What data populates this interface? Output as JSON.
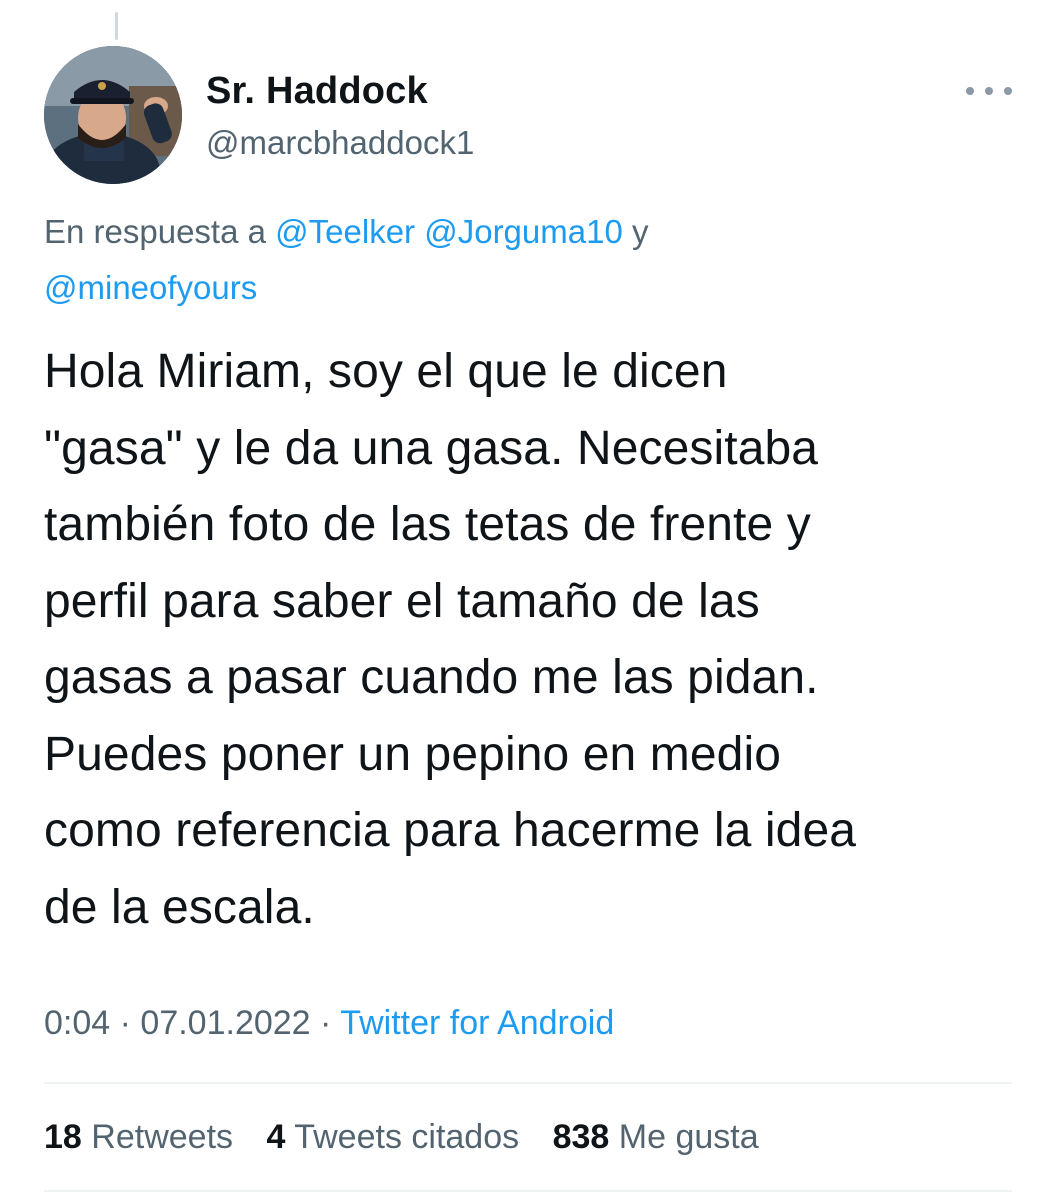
{
  "author": {
    "name": "Sr. Haddock",
    "handle": "@marcbhaddock1"
  },
  "reply_context": {
    "prefix": "En respuesta a",
    "mentions": [
      "@Teelker",
      "@Jorguma10",
      "@mineofyours"
    ],
    "conjunction": "y"
  },
  "tweet": {
    "lines": [
      "Hola Miriam, soy el que le dicen",
      "\"gasa\" y le da una gasa. Necesitaba",
      "también foto de las tetas de frente y",
      "perfil para saber el tamaño de las",
      "gasas a pasar cuando me las pidan.",
      "Puedes poner un pepino en medio",
      "como referencia para hacerme la idea",
      "de la escala."
    ]
  },
  "meta": {
    "time": "0:04",
    "separator": "·",
    "date": "07.01.2022",
    "source": "Twitter for Android"
  },
  "stats": {
    "retweets": {
      "count": "18",
      "label": "Retweets"
    },
    "quotes": {
      "count": "4",
      "label": "Tweets citados"
    },
    "likes": {
      "count": "838",
      "label": "Me gusta"
    }
  },
  "icons": {
    "more": "more-horizontal-icon",
    "avatar": "avatar-image"
  },
  "colors": {
    "text_primary": "#0f1419",
    "text_secondary": "#536471",
    "link": "#1d9bf0",
    "divider": "#eff3f4"
  }
}
